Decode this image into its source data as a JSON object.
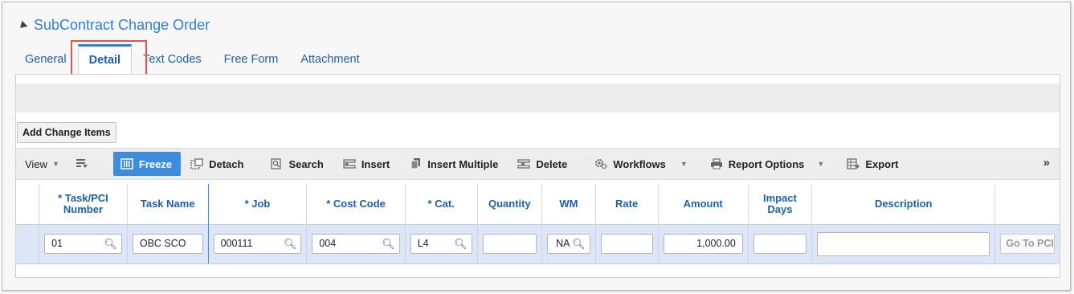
{
  "panel": {
    "title": "SubContract Change Order"
  },
  "tabs": [
    {
      "label": "General"
    },
    {
      "label": "Detail"
    },
    {
      "label": "Text Codes"
    },
    {
      "label": "Free Form"
    },
    {
      "label": "Attachment"
    }
  ],
  "actions": {
    "add_change_items": "Add Change Items"
  },
  "toolbar": {
    "view": "View",
    "freeze": "Freeze",
    "detach": "Detach",
    "search": "Search",
    "insert": "Insert",
    "insert_multiple": "Insert Multiple",
    "delete": "Delete",
    "workflows": "Workflows",
    "report_options": "Report Options",
    "export": "Export",
    "more": "»"
  },
  "grid": {
    "columns": {
      "task_pci_line1": "* Task/PCI",
      "task_pci_line2": "Number",
      "task_name": "Task Name",
      "job": "* Job",
      "cost_code": "* Cost Code",
      "cat": "* Cat.",
      "quantity": "Quantity",
      "wm": "WM",
      "rate": "Rate",
      "amount": "Amount",
      "impact_line1": "Impact",
      "impact_line2": "Days",
      "description": "Description"
    },
    "row": {
      "task_pci": "01",
      "task_name": "OBC SCO",
      "job": "000111",
      "cost_code": "004",
      "cat": "L4",
      "quantity": "",
      "wm": "NA",
      "rate": "",
      "amount": "1,000.00",
      "impact_days": "",
      "description": "",
      "goto": "Go To PCI"
    }
  },
  "colors": {
    "accent": "#3c8dde",
    "title": "#2f7fd8",
    "highlight": "#e0534e",
    "row_bg": "#dce6f7"
  }
}
